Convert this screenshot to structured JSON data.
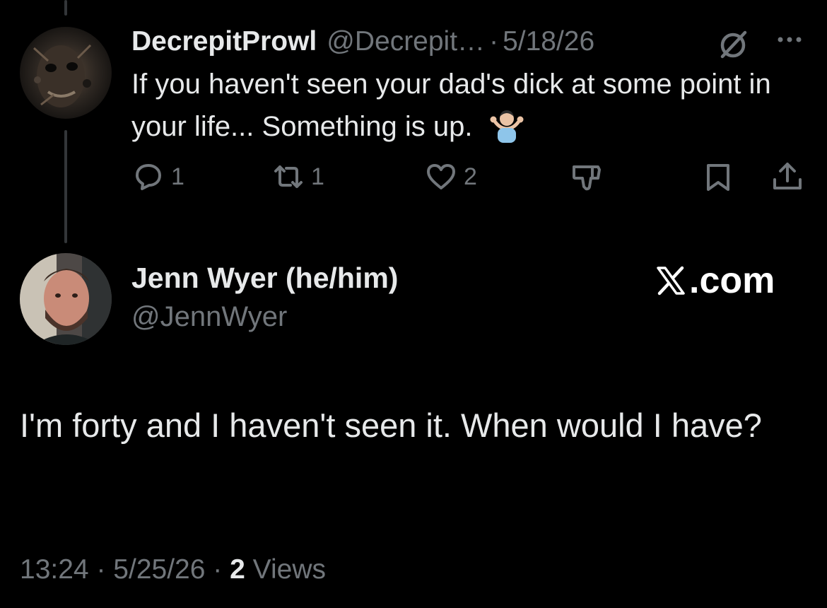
{
  "parent_tweet": {
    "display_name": "DecrepitProwl",
    "handle": "@Decrepit…",
    "separator": "·",
    "date": "5/18/26",
    "text": "If you haven't seen your dad's dick at some point in your life... Something is up.",
    "emoji": "person-shrugging-emoji",
    "actions": {
      "reply_count": "1",
      "repost_count": "1",
      "like_count": "2"
    },
    "icons": [
      "grok-icon",
      "more-icon",
      "reply-icon",
      "repost-icon",
      "like-icon",
      "dislike-icon",
      "bookmark-icon",
      "share-icon"
    ]
  },
  "reply_tweet": {
    "display_name": "Jenn Wyer (he/him)",
    "handle": "@JennWyer",
    "text": "I'm forty and I haven't seen it. When would I have?",
    "time": "13:24",
    "separator": "·",
    "date": "5/25/26",
    "views_count": "2",
    "views_label": "Views"
  },
  "brand": {
    "logo": "x-logo-icon",
    "suffix": ".com"
  },
  "colors": {
    "background": "#000000",
    "primary_text": "#e7e9ea",
    "secondary_text": "#71767b",
    "thread_line": "#333639"
  }
}
